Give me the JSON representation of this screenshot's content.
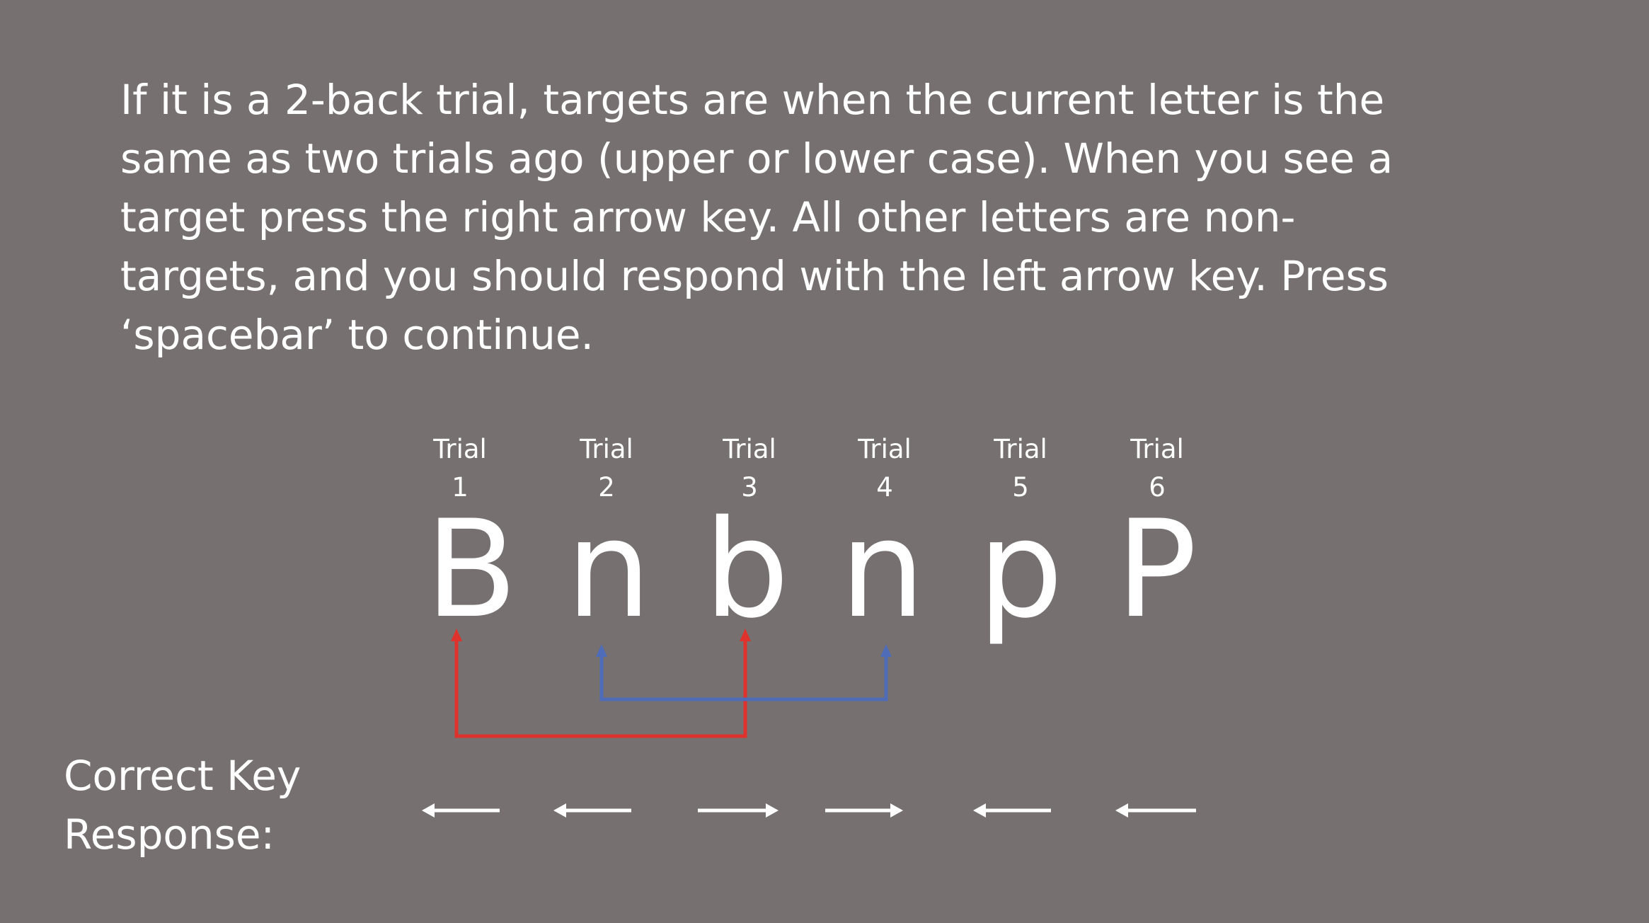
{
  "instructions": "If it is a 2-back trial, targets are when the current letter is the same as two trials ago (upper or lower case). When you see a target press the right arrow key. All other letters are non-targets, and you should respond with the left arrow key. Press ‘spacebar’ to continue.",
  "trials": [
    {
      "label": "Trial",
      "number": "1",
      "letter": "B",
      "response": "left"
    },
    {
      "label": "Trial",
      "number": "2",
      "letter": "n",
      "response": "left"
    },
    {
      "label": "Trial",
      "number": "3",
      "letter": "b",
      "response": "right"
    },
    {
      "label": "Trial",
      "number": "4",
      "letter": "n",
      "response": "right"
    },
    {
      "label": "Trial",
      "number": "5",
      "letter": "p",
      "response": "left"
    },
    {
      "label": "Trial",
      "number": "6",
      "letter": "P",
      "response": "left"
    }
  ],
  "correct_key": {
    "line1": "Correct Key",
    "line2": "Response:"
  },
  "links": [
    {
      "from": 1,
      "to": 3,
      "color": "#e0322c"
    },
    {
      "from": 2,
      "to": 4,
      "color": "#4f6cb8"
    }
  ],
  "colors": {
    "background": "#767070",
    "text": "#ffffff"
  }
}
